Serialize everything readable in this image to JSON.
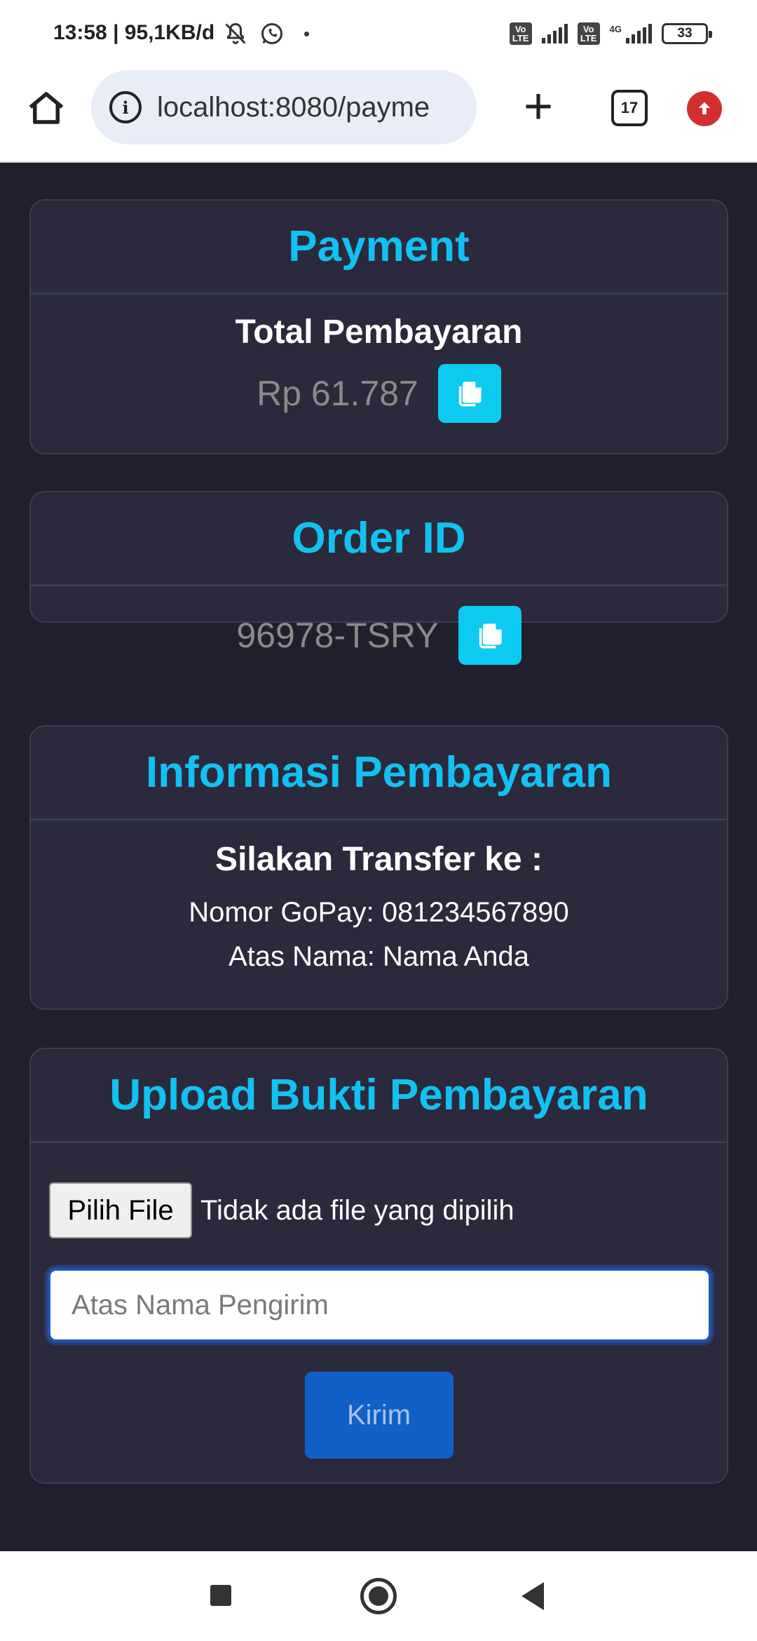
{
  "status_bar": {
    "time": "13:58 | 95,1KB/d",
    "signal_1_label": "Vo LTE",
    "signal_2_label": "Vo LTE",
    "network_type": "4G",
    "battery": "33"
  },
  "browser": {
    "url": "localhost:8080/payme",
    "tab_count": "17"
  },
  "payment_card": {
    "title": "Payment",
    "subheading": "Total Pembayaran",
    "amount": "Rp 61.787"
  },
  "order_card": {
    "title": "Order ID",
    "order_id": "96978-TSRY"
  },
  "info_card": {
    "title": "Informasi Pembayaran",
    "subheading": "Silakan Transfer ke :",
    "gopay_line": "Nomor GoPay: 081234567890",
    "name_line": "Atas Nama: Nama Anda"
  },
  "upload_card": {
    "title": "Upload Bukti Pembayaran",
    "file_button": "Pilih File",
    "file_status": "Tidak ada file yang dipilih",
    "sender_placeholder": "Atas Nama Pengirim",
    "submit_label": "Kirim"
  },
  "colors": {
    "accent": "#12c1f2",
    "background": "#1f1f2e",
    "card": "#2a2a3c",
    "submit": "#1060c8"
  }
}
